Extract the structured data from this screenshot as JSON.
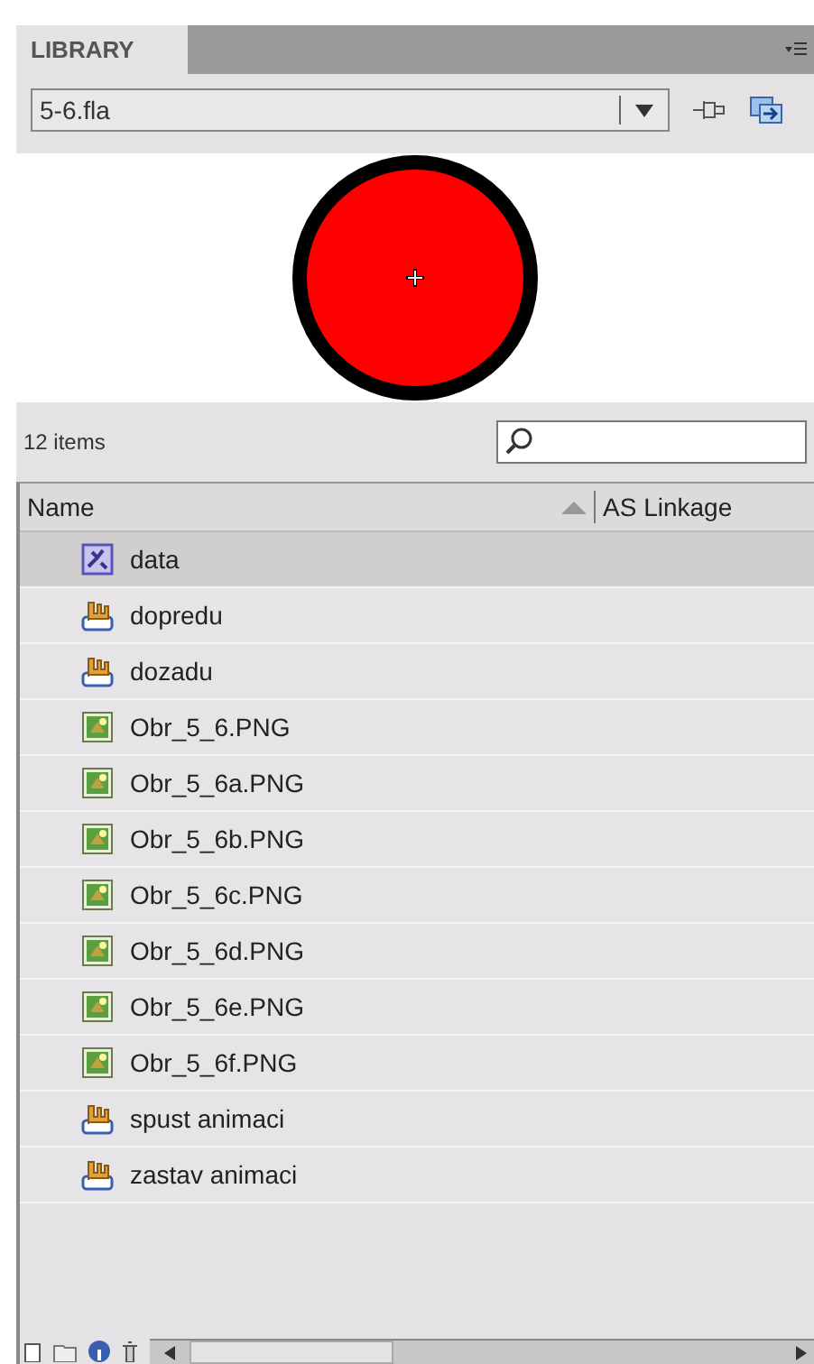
{
  "panel": {
    "tab": "LIBRARY"
  },
  "document": {
    "value": "5-6.fla"
  },
  "status": {
    "count": "12 items"
  },
  "columns": [
    "Name",
    "AS Linkage"
  ],
  "items": [
    {
      "name": "data",
      "kind": "graphic",
      "selected": true
    },
    {
      "name": "dopredu",
      "kind": "button",
      "selected": false
    },
    {
      "name": "dozadu",
      "kind": "button",
      "selected": false
    },
    {
      "name": "Obr_5_6.PNG",
      "kind": "bitmap",
      "selected": false
    },
    {
      "name": "Obr_5_6a.PNG",
      "kind": "bitmap",
      "selected": false
    },
    {
      "name": "Obr_5_6b.PNG",
      "kind": "bitmap",
      "selected": false
    },
    {
      "name": "Obr_5_6c.PNG",
      "kind": "bitmap",
      "selected": false
    },
    {
      "name": "Obr_5_6d.PNG",
      "kind": "bitmap",
      "selected": false
    },
    {
      "name": "Obr_5_6e.PNG",
      "kind": "bitmap",
      "selected": false
    },
    {
      "name": "Obr_5_6f.PNG",
      "kind": "bitmap",
      "selected": false
    },
    {
      "name": "spust animaci",
      "kind": "button",
      "selected": false
    },
    {
      "name": "zastav animaci",
      "kind": "button",
      "selected": false
    }
  ]
}
